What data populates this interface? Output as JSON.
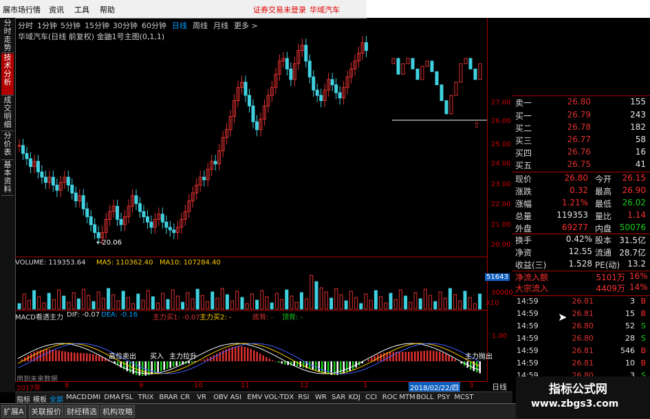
{
  "menu": {
    "items": [
      "展市场行情",
      "资讯",
      "工具",
      "帮助"
    ],
    "login_status": "证券交易未登录",
    "stock_name": "华域汽车"
  },
  "left_tabs": [
    "分时走势",
    "技术分析",
    "成交明细",
    "分价表",
    "基本资料"
  ],
  "periods": [
    "分时",
    "1分钟",
    "5分钟",
    "15分钟",
    "30分钟",
    "60分钟",
    "日线",
    "周线",
    "月线",
    "更多 >"
  ],
  "chart_title": "华域汽车(日线 前复权) 金鼬1号主图(0,1,1)",
  "price_ticks": [
    "27.00",
    "26.00",
    "25.00",
    "24.00",
    "23.00",
    "22.00",
    "21.00",
    "20.00"
  ],
  "low_label": "←20.06",
  "volume_header": {
    "vol": "VOLUME: 119353.64",
    "ma5": "MA5: 110362.40",
    "ma10": "MA10: 107284.40"
  },
  "volume_badge": "51643",
  "volume_tick": "30000",
  "volume_unit": "X10",
  "macd_header": {
    "name": "MACD看透主力",
    "dif": "DIF: -0.07",
    "dea": "DEA: -0.16",
    "buy1": "主力买1: -0.07",
    "buy2": "主力买2: -",
    "top": "底背: -",
    "bottom": "顶背: -"
  },
  "macd_tick": "1.00",
  "macd_labels": [
    "高位卖出",
    "买入",
    "主力拉升",
    "主力抛出"
  ],
  "future_label": "用到未来数据",
  "order_book": [
    {
      "label": "卖一",
      "price": "26.80",
      "vol": "155"
    },
    {
      "label": "买一",
      "price": "26.79",
      "vol": "243"
    },
    {
      "label": "买二",
      "price": "26.78",
      "vol": "182"
    },
    {
      "label": "买三",
      "price": "26.77",
      "vol": "58"
    },
    {
      "label": "买四",
      "price": "26.76",
      "vol": "16"
    },
    {
      "label": "买五",
      "price": "26.75",
      "vol": "41"
    }
  ],
  "stats": [
    {
      "l1": "现价",
      "v1": "26.80",
      "l2": "今开",
      "v2": "26.15",
      "c2": "red"
    },
    {
      "l1": "涨跌",
      "v1": "0.32",
      "l2": "最高",
      "v2": "26.90",
      "c2": "red"
    },
    {
      "l1": "涨幅",
      "v1": "1.21%",
      "l2": "最低",
      "v2": "26.02",
      "c2": "grn"
    },
    {
      "l1": "总量",
      "v1": "119353",
      "l2": "量比",
      "v2": "1.14",
      "c2": "red",
      "w1": true
    },
    {
      "l1": "外盘",
      "v1": "69277",
      "l2": "内盘",
      "v2": "50076",
      "c2": "grn"
    }
  ],
  "stats2": [
    {
      "l1": "换手",
      "v1": "0.42%",
      "l2": "股本",
      "v2": "31.5亿"
    },
    {
      "l1": "净资",
      "v1": "12.55",
      "l2": "流通",
      "v2": "28.7亿"
    },
    {
      "l1": "收益(三)",
      "v1": "1.528",
      "l2": "PE(动)",
      "v2": "13.2"
    }
  ],
  "flows": [
    {
      "label": "净流入额",
      "value": "5101万",
      "pct": "16%"
    },
    {
      "label": "大宗流入",
      "value": "4409万",
      "pct": "14%"
    }
  ],
  "ticks": [
    {
      "time": "14:59",
      "price": "26.81",
      "vol": "3",
      "flag": "B"
    },
    {
      "time": "14:59",
      "price": "26.81",
      "vol": "15",
      "flag": "B"
    },
    {
      "time": "14:59",
      "price": "26.80",
      "vol": "52",
      "flag": "S"
    },
    {
      "time": "14:59",
      "price": "26.80",
      "vol": "28",
      "flag": "S"
    },
    {
      "time": "14:59",
      "price": "26.81",
      "vol": "546",
      "flag": "B"
    },
    {
      "time": "14:59",
      "price": "26.81",
      "vol": "10",
      "flag": "B"
    },
    {
      "time": "14:59",
      "price": "26.80",
      "vol": "3",
      "flag": "S"
    }
  ],
  "date_ticks": [
    "2017年",
    "8",
    "9",
    "10",
    "11",
    "12",
    "1"
  ],
  "current_date": "2018/02/22/四",
  "date_end": "3",
  "day_button": "日线",
  "indicators": [
    "指标",
    "模板",
    "全部",
    "MACD",
    "DMI",
    "DMA",
    "FSL",
    "TRIX",
    "BRAR",
    "CR",
    "VR",
    "OBV",
    "ASI",
    "EMV",
    "VOL-TDX",
    "RSI",
    "WR",
    "SAR",
    "KDJ",
    "CCI",
    "ROC",
    "MTM",
    "BOLL",
    "PSY",
    "MCST"
  ],
  "bottom_tabs": [
    "扩展A",
    "关联报价",
    "财经精选",
    "机构攻略"
  ],
  "watermark": {
    "line1": "指标公式网",
    "line2": "www.zbgs3.com"
  },
  "chart_data": {
    "type": "candlestick",
    "ylim": [
      20,
      27.6
    ],
    "closes": [
      23.7,
      23.4,
      23.2,
      22.9,
      23.1,
      22.7,
      22.5,
      22.3,
      22.5,
      22.2,
      22.0,
      22.3,
      22.5,
      22.2,
      21.9,
      21.6,
      21.8,
      21.3,
      21.0,
      20.7,
      20.4,
      20.2,
      20.4,
      20.9,
      21.2,
      21.4,
      20.9,
      20.7,
      21.0,
      21.4,
      21.8,
      21.5,
      21.2,
      21.0,
      20.8,
      20.6,
      20.9,
      21.1,
      20.8,
      20.6,
      20.5,
      20.4,
      20.6,
      20.9,
      21.2,
      21.6,
      21.9,
      22.2,
      22.5,
      22.4,
      22.8,
      23.1,
      23.0,
      23.5,
      24.0,
      24.3,
      24.8,
      25.4,
      25.9,
      26.1,
      25.6,
      25.2,
      24.6,
      24.3,
      24.7,
      25.2,
      25.6,
      25.9,
      26.4,
      26.9,
      27.0,
      26.6,
      26.2,
      26.8,
      27.3,
      27.5,
      26.9,
      26.3,
      25.8,
      25.6,
      25.4,
      25.8,
      26.2,
      26.0,
      25.7,
      25.5,
      25.9,
      26.3,
      26.6,
      26.9,
      27.2,
      27.6,
      27.3
    ]
  }
}
